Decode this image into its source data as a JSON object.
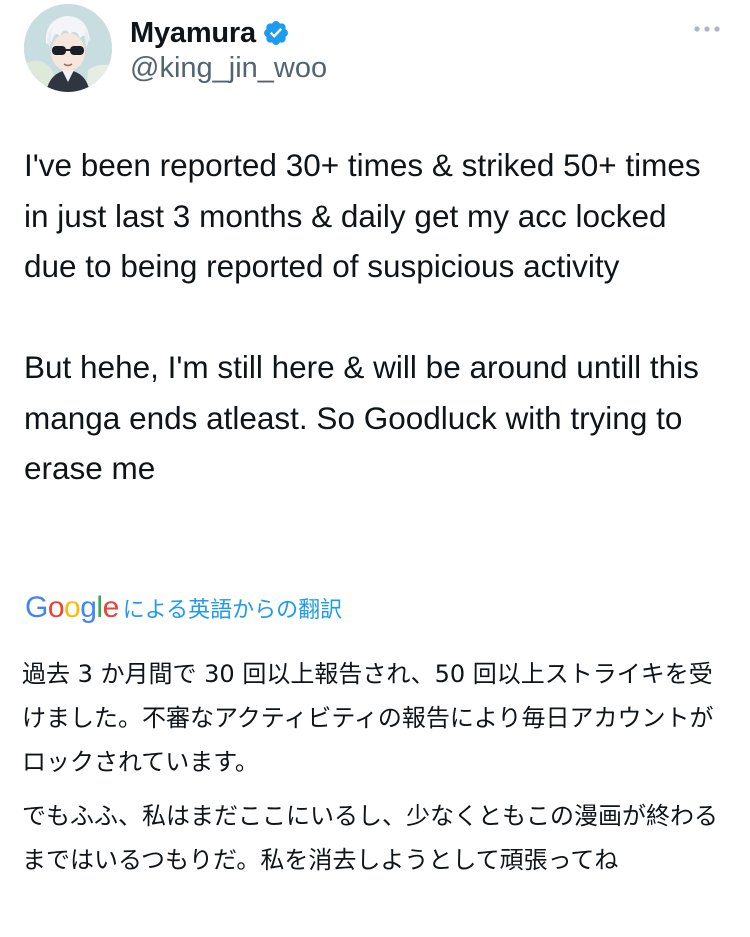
{
  "author": {
    "display_name": "Myamura",
    "handle": "@king_jin_woo",
    "verified": true,
    "avatar_icon": "anime-character-avatar",
    "verified_color": "#1d9bf0"
  },
  "tweet": {
    "paragraphs": [
      "I've been reported 30+ times & striked 50+ times in just last 3 months & daily get my acc locked due to being reported of suspicious activity",
      "But hehe, I'm still here & will be around untill this manga ends atleast. So Goodluck with trying to erase me"
    ]
  },
  "translation": {
    "provider": "Google",
    "label": "による英語からの翻訳",
    "paragraphs": [
      "過去 3 か月間で 30 回以上報告され、50 回以上ストライキを受けました。不審なアクティビティの報告により毎日アカウントがロックされています。",
      "でもふふ、私はまだここにいるし、少なくともこの漫画が終わるまではいるつもりだ。私を消去しようとして頑張ってね"
    ],
    "link_color": "#1d9bf0"
  },
  "more_icon": "more-options-icon"
}
